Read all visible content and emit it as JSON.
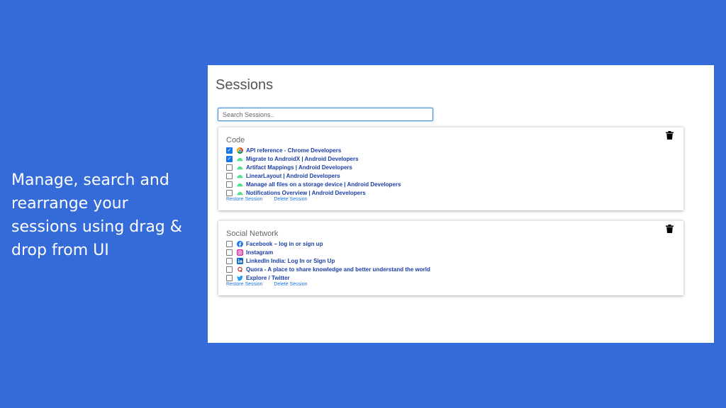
{
  "promo": {
    "text": "Manage, search and rearrange your sessions using drag & drop from UI"
  },
  "header": {
    "title": "Sessions"
  },
  "search": {
    "placeholder": "Search Sessions.."
  },
  "sessions": [
    {
      "name": "Code",
      "tabs": [
        {
          "title": "API reference - Chrome Developers",
          "icon": "chrome-icon",
          "checked": true
        },
        {
          "title": "Migrate to AndroidX  |  Android Developers",
          "icon": "android-icon",
          "checked": true
        },
        {
          "title": "Artifact Mappings  |  Android Developers",
          "icon": "android-icon",
          "checked": false
        },
        {
          "title": "LinearLayout  |  Android Developers",
          "icon": "android-icon",
          "checked": false
        },
        {
          "title": "Manage all files on a storage device  |  Android Developers",
          "icon": "android-icon",
          "checked": false
        },
        {
          "title": "Notifications Overview  |  Android Developers",
          "icon": "android-icon",
          "checked": false
        }
      ],
      "restore_label": "Restore Session",
      "delete_label": "Delete Session"
    },
    {
      "name": "Social Network",
      "tabs": [
        {
          "title": "Facebook – log in or sign up",
          "icon": "facebook-icon",
          "checked": false
        },
        {
          "title": "Instagram",
          "icon": "instagram-icon",
          "checked": false
        },
        {
          "title": "LinkedIn India: Log In or Sign Up",
          "icon": "linkedin-icon",
          "checked": false
        },
        {
          "title": "Quora - A place to share knowledge and better understand the world",
          "icon": "quora-icon",
          "checked": false
        },
        {
          "title": "Explore / Twitter",
          "icon": "twitter-icon",
          "checked": false
        }
      ],
      "restore_label": "Restore Session",
      "delete_label": "Delete Session"
    }
  ],
  "colors": {
    "background": "#356bd8",
    "link": "#1a3fa6",
    "action": "#1a73e8",
    "panel": "#ffffff"
  }
}
